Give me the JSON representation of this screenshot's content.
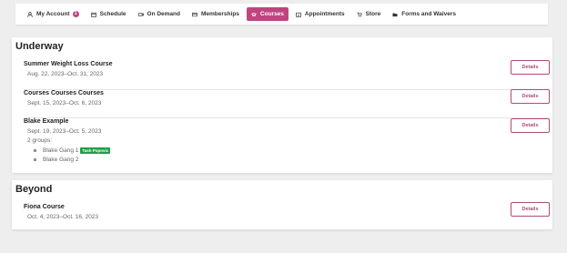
{
  "nav": {
    "items": [
      {
        "label": "My Account",
        "icon": "user-icon",
        "badge": "1"
      },
      {
        "label": "Schedule",
        "icon": "calendar-icon"
      },
      {
        "label": "On Demand",
        "icon": "video-icon"
      },
      {
        "label": "Memberships",
        "icon": "card-icon"
      },
      {
        "label": "Courses",
        "icon": "courses-icon",
        "active": true
      },
      {
        "label": "Appointments",
        "icon": "appointment-icon"
      },
      {
        "label": "Store",
        "icon": "cart-icon"
      },
      {
        "label": "Forms and Waivers",
        "icon": "folder-icon"
      }
    ],
    "active_color": "#c0457f"
  },
  "sections": {
    "underway": {
      "title": "Underway",
      "courses": [
        {
          "title": "Summer Weight Loss Course",
          "dates": "Aug. 22, 2023–Oct. 31, 2023",
          "button": "Details"
        },
        {
          "title": "Courses Courses Courses",
          "dates": "Sept. 15, 2023–Oct. 6, 2023",
          "button": "Details"
        },
        {
          "title": "Blake Example",
          "dates": "Sept. 19, 2023–Oct. 5, 2023",
          "button": "Details",
          "groups_label": "2 groups:",
          "groups": [
            {
              "name": "Blake Gang 1",
              "tag": "Tash Popovic"
            },
            {
              "name": "Blake Gang 2"
            }
          ]
        }
      ]
    },
    "beyond": {
      "title": "Beyond",
      "courses": [
        {
          "title": "Fiona Course",
          "dates": "Oct. 4, 2023–Oct. 16, 2023",
          "button": "Details"
        }
      ]
    }
  },
  "colors": {
    "accent": "#b04a7c",
    "tag": "#1e9e4a"
  }
}
